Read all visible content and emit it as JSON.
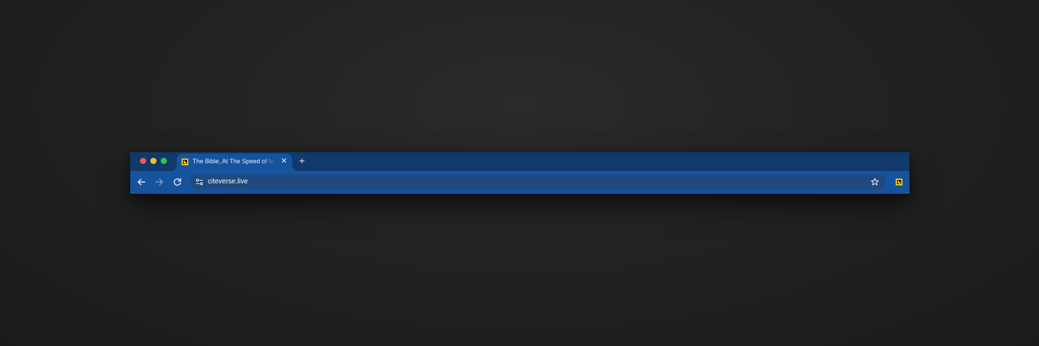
{
  "window": {
    "traffic_lights": [
      "close",
      "minimize",
      "maximize"
    ]
  },
  "tabs": [
    {
      "title": "The Bible, At The Speed of Vo",
      "favicon": "citeverse-favicon",
      "close_icon": "close-icon",
      "active": true
    }
  ],
  "new_tab_icon": "plus-icon",
  "toolbar": {
    "back_icon": "arrow-left-icon",
    "forward_icon": "arrow-right-icon",
    "reload_icon": "reload-icon",
    "omnibox": {
      "site_info_icon": "tune-icon",
      "url": "citeverse.live",
      "bookmark_icon": "star-icon"
    },
    "extension_icon": "citeverse-favicon"
  },
  "colors": {
    "tabstrip": "#0f3a6b",
    "toolbar": "#15539e",
    "omnibox": "#1f4a80",
    "close": "#ee5a52",
    "minimize": "#f4bd2f",
    "maximize": "#2ac840",
    "favicon": "#e9c21a"
  }
}
